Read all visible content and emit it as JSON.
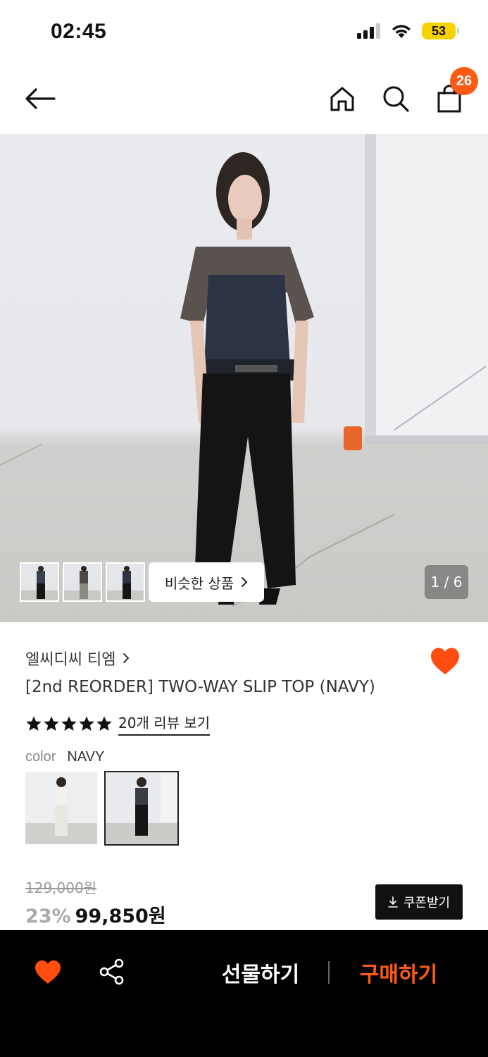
{
  "status_bar": {
    "time": "02:45",
    "battery": "53",
    "icons": [
      "signal-icon",
      "wifi-icon",
      "battery-icon"
    ]
  },
  "nav": {
    "icons": [
      "back-arrow-icon",
      "home-icon",
      "search-icon",
      "shopping-bag-icon"
    ],
    "cart_count": "26"
  },
  "gallery": {
    "similar_label": "비슷한 상품",
    "page_indicator": "1 / 6",
    "thumbnail_count": 3
  },
  "product": {
    "brand": "엘씨디씨 티엠",
    "title": "[2nd REORDER] TWO-WAY SLIP TOP (NAVY)",
    "rating_stars": 5,
    "review_link": "20개 리뷰 보기",
    "color_label": "color",
    "color_value": "NAVY",
    "swatches": [
      "white-variant",
      "navy-variant"
    ],
    "selected_swatch": 1
  },
  "price": {
    "original": "129,000원",
    "discount": "23%",
    "sale": "99,850원",
    "coupon_label": "쿠폰받기"
  },
  "bottom_bar": {
    "gift_label": "선물하기",
    "buy_label": "구매하기"
  },
  "colors": {
    "accent": "#ff5a14",
    "heart": "#ff4d12",
    "bottom_bar_bg": "#000000"
  }
}
